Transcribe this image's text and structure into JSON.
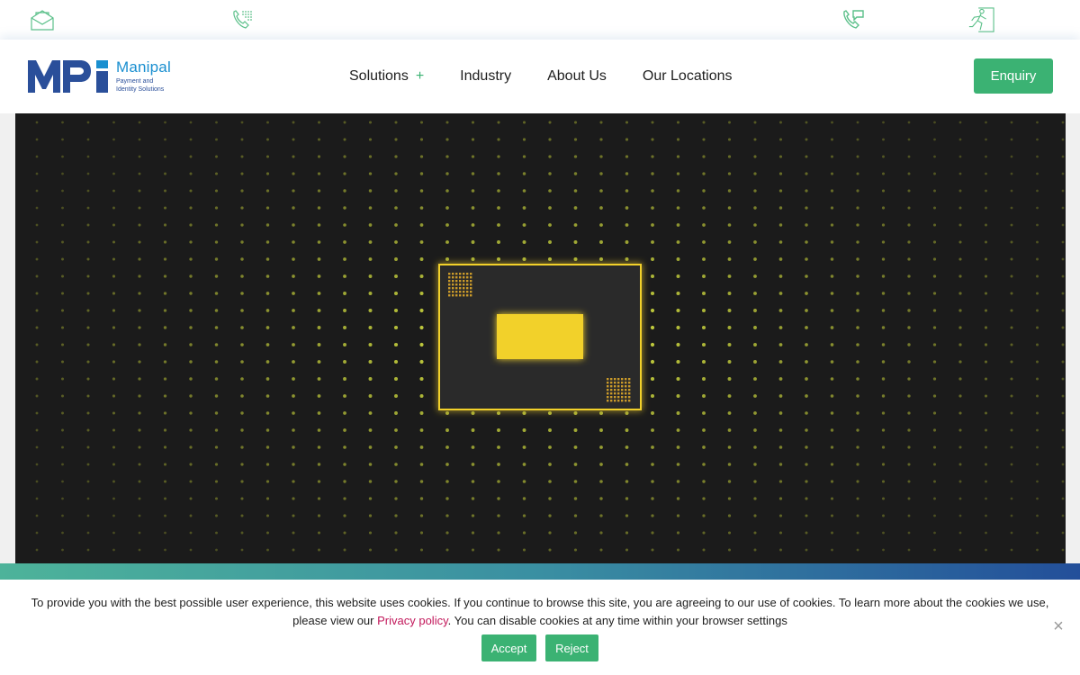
{
  "topbar": {
    "icons": [
      "mail-open-icon",
      "phone-dialpad-icon",
      "phone-chat-icon",
      "exit-run-icon"
    ]
  },
  "logo": {
    "brand": "MPi",
    "name": "Manipal",
    "tagline_line1": "Payment and",
    "tagline_line2": "Identity Solutions"
  },
  "nav": {
    "items": [
      {
        "label": "Solutions",
        "has_submenu": true,
        "submenu_symbol": "+"
      },
      {
        "label": "Industry"
      },
      {
        "label": "About Us"
      },
      {
        "label": "Our Locations"
      }
    ]
  },
  "header": {
    "cta_label": "Enquiry"
  },
  "hero": {
    "content": "chip-card-animation-image"
  },
  "cookie": {
    "text_before": "To provide you with the best possible user experience, this website uses cookies. If you continue to browse this site, you are agreeing to our use of cookies. To learn more about the cookies we use, please view our ",
    "link_text": "Privacy policy",
    "text_after": ". You can disable cookies at any time within your browser settings",
    "accept_label": "Accept",
    "reject_label": "Reject",
    "close_symbol": "×"
  },
  "colors": {
    "accent_green": "#3bb273",
    "brand_blue": "#1a8fd0",
    "brand_navy": "#2a4f9a",
    "link_pink": "#c2185b",
    "hero_bg": "#1b1b1b",
    "chip_yellow": "#f2d12c"
  }
}
